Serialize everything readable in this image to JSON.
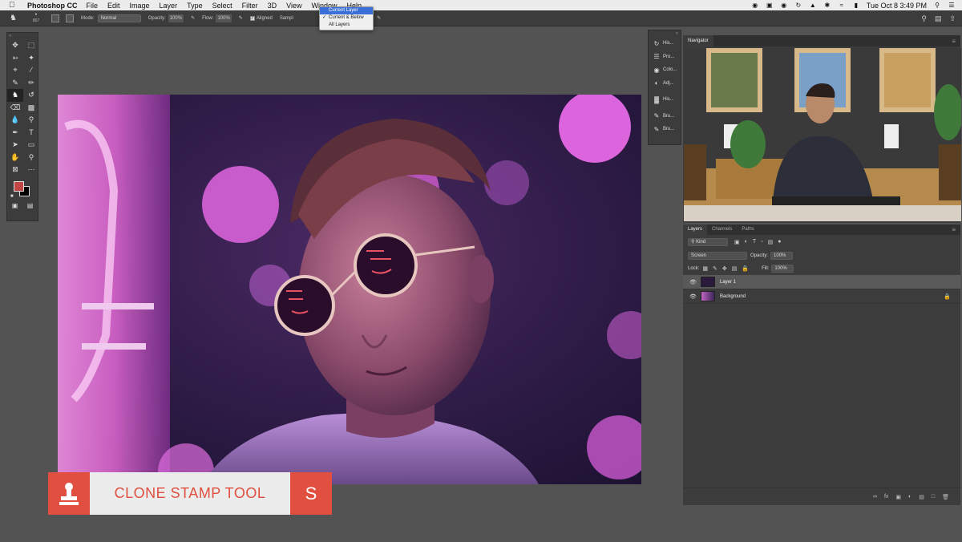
{
  "menubar": {
    "app_name": "Photoshop CC",
    "items": [
      "File",
      "Edit",
      "Image",
      "Layer",
      "Type",
      "Select",
      "Filter",
      "3D",
      "View",
      "Window",
      "Help"
    ],
    "clock": "Tue Oct 8  3:49 PM"
  },
  "sample_menu": {
    "options": [
      "Current Layer",
      "Current & Below",
      "All Layers"
    ],
    "highlighted": "Current Layer",
    "checked": "Current & Below"
  },
  "options_bar": {
    "brush_size": "807",
    "mode_label": "Mode:",
    "mode_value": "Normal",
    "opacity_label": "Opacity:",
    "opacity_value": "100%",
    "flow_label": "Flow:",
    "flow_value": "100%",
    "aligned_label": "Aligned",
    "sample_label": "Sampl"
  },
  "toolbar": {
    "tools": [
      "move-icon",
      "marquee-icon",
      "lasso-icon",
      "magic-wand-icon",
      "crop-icon",
      "eyedropper-icon",
      "healing-icon",
      "brush-icon",
      "clone-stamp-icon",
      "history-brush-icon",
      "eraser-icon",
      "gradient-icon",
      "blur-icon",
      "dodge-icon",
      "pen-icon",
      "type-icon",
      "path-select-icon",
      "shape-icon",
      "hand-icon",
      "zoom-icon",
      "frame-icon",
      "more-icon"
    ],
    "active_tool": "clone-stamp-icon",
    "foreground_color": "#c24545",
    "background_color": "#000000"
  },
  "dock": {
    "items": [
      "His...",
      "Pro...",
      "Colo...",
      "Adj...",
      "His...",
      "Bru...",
      "Bru..."
    ]
  },
  "navigator": {
    "tab": "Navigator"
  },
  "layers_panel": {
    "tabs": [
      "Layers",
      "Channels",
      "Paths"
    ],
    "filter_kind": "Kind",
    "blend_mode": "Screen",
    "opacity_label": "Opacity:",
    "opacity_value": "100%",
    "lock_label": "Lock:",
    "fill_label": "Fill:",
    "fill_value": "100%",
    "layers": [
      {
        "name": "Layer 1",
        "selected": true,
        "locked": false
      },
      {
        "name": "Background",
        "selected": false,
        "locked": true
      }
    ]
  },
  "lower_third": {
    "title": "CLONE STAMP TOOL",
    "shortcut": "S",
    "accent": "#e04f3f"
  }
}
